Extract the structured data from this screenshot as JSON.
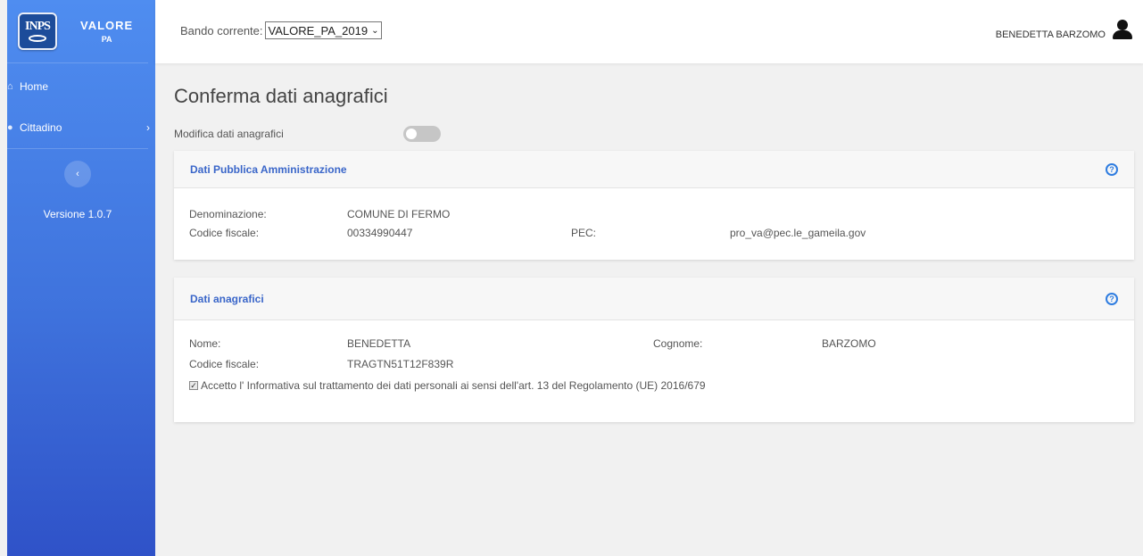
{
  "sidebar": {
    "logo_text": "INPS",
    "brand_title": "VALORE",
    "brand_subtitle": "PA",
    "items": [
      {
        "label": "Home",
        "icon": "home-icon"
      },
      {
        "label": "Cittadino",
        "icon": "user-icon"
      }
    ],
    "version": "Versione 1.0.7"
  },
  "topbar": {
    "bando_label": "Bando corrente:",
    "bando_value": "VALORE_PA_2019",
    "user_name": "BENEDETTA BARZOMO"
  },
  "main": {
    "title": "Conferma dati anagrafici",
    "modifica_label": "Modifica dati anagrafici",
    "pa_card": {
      "title": "Dati Pubblica Amministrazione",
      "denominazione_label": "Denominazione:",
      "denominazione_value": "COMUNE DI FERMO",
      "cf_label": "Codice fiscale:",
      "cf_value": "00334990447",
      "pec_label": "PEC:",
      "pec_value": "pro_va@pec.le_gameila.gov"
    },
    "anag_card": {
      "title": "Dati anagrafici",
      "nome_label": "Nome:",
      "nome_value": "BENEDETTA",
      "cognome_label": "Cognome:",
      "cognome_value": "BARZOMO",
      "cf_label": "Codice fiscale:",
      "cf_value": "TRAGTN51T12F839R",
      "consent_text": "Accetto l' Informativa sul trattamento dei dati personali ai sensi dell'art. 13 del Regolamento (UE) 2016/679"
    }
  },
  "colors": {
    "sidebar_top": "#4f8df0",
    "sidebar_bottom": "#2f52c8",
    "accent": "#3a66c9",
    "help_icon": "#2f7de0"
  }
}
